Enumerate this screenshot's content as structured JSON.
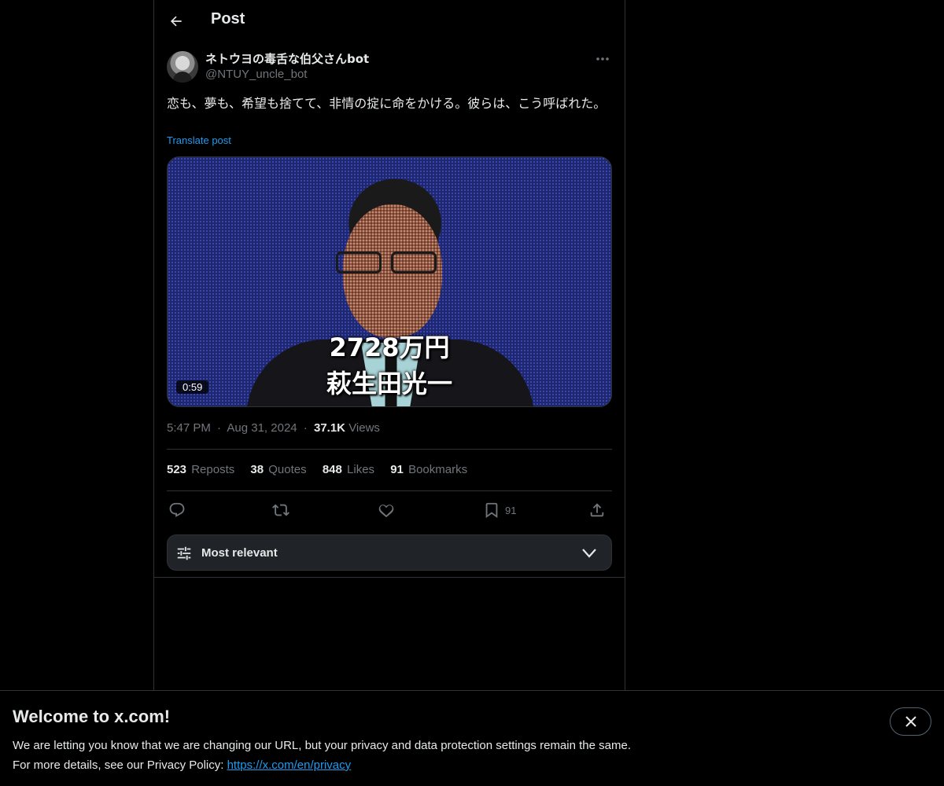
{
  "header": {
    "title": "Post"
  },
  "author": {
    "name": "ネトウヨの毒舌な伯父さんbot",
    "handle": "@NTUY_uncle_bot"
  },
  "tweet": {
    "text": "恋も、夢も、希望も捨てて、非情の掟に命をかける。彼らは、こう呼ばれた。",
    "translate_label": "Translate post"
  },
  "media": {
    "caption_amount": "2728万円",
    "caption_name": "萩生田光一",
    "duration": "0:59"
  },
  "meta": {
    "time": "5:47 PM",
    "date": "Aug 31, 2024",
    "views_count": "37.1K",
    "views_label": "Views",
    "separator": "·"
  },
  "stats": {
    "reposts_count": "523",
    "reposts_label": "Reposts",
    "quotes_count": "38",
    "quotes_label": "Quotes",
    "likes_count": "848",
    "likes_label": "Likes",
    "bookmarks_count": "91",
    "bookmarks_label": "Bookmarks"
  },
  "actions": {
    "reply_icon": "reply-icon",
    "repost_icon": "repost-icon",
    "like_icon": "heart-icon",
    "bookmark_icon": "bookmark-icon",
    "bookmark_count": "91",
    "share_icon": "share-icon"
  },
  "sort": {
    "label": "Most relevant"
  },
  "banner": {
    "title": "Welcome to x.com!",
    "line1": "We are letting you know that we are changing our URL, but your privacy and data protection settings remain the same.",
    "line2_prefix": "For more details, see our Privacy Policy: ",
    "link": "https://x.com/en/privacy"
  },
  "colors": {
    "background": "#000000",
    "text": "#e7e9ea",
    "muted": "#71767b",
    "accent": "#1d9bf0",
    "border": "#2f3336"
  }
}
